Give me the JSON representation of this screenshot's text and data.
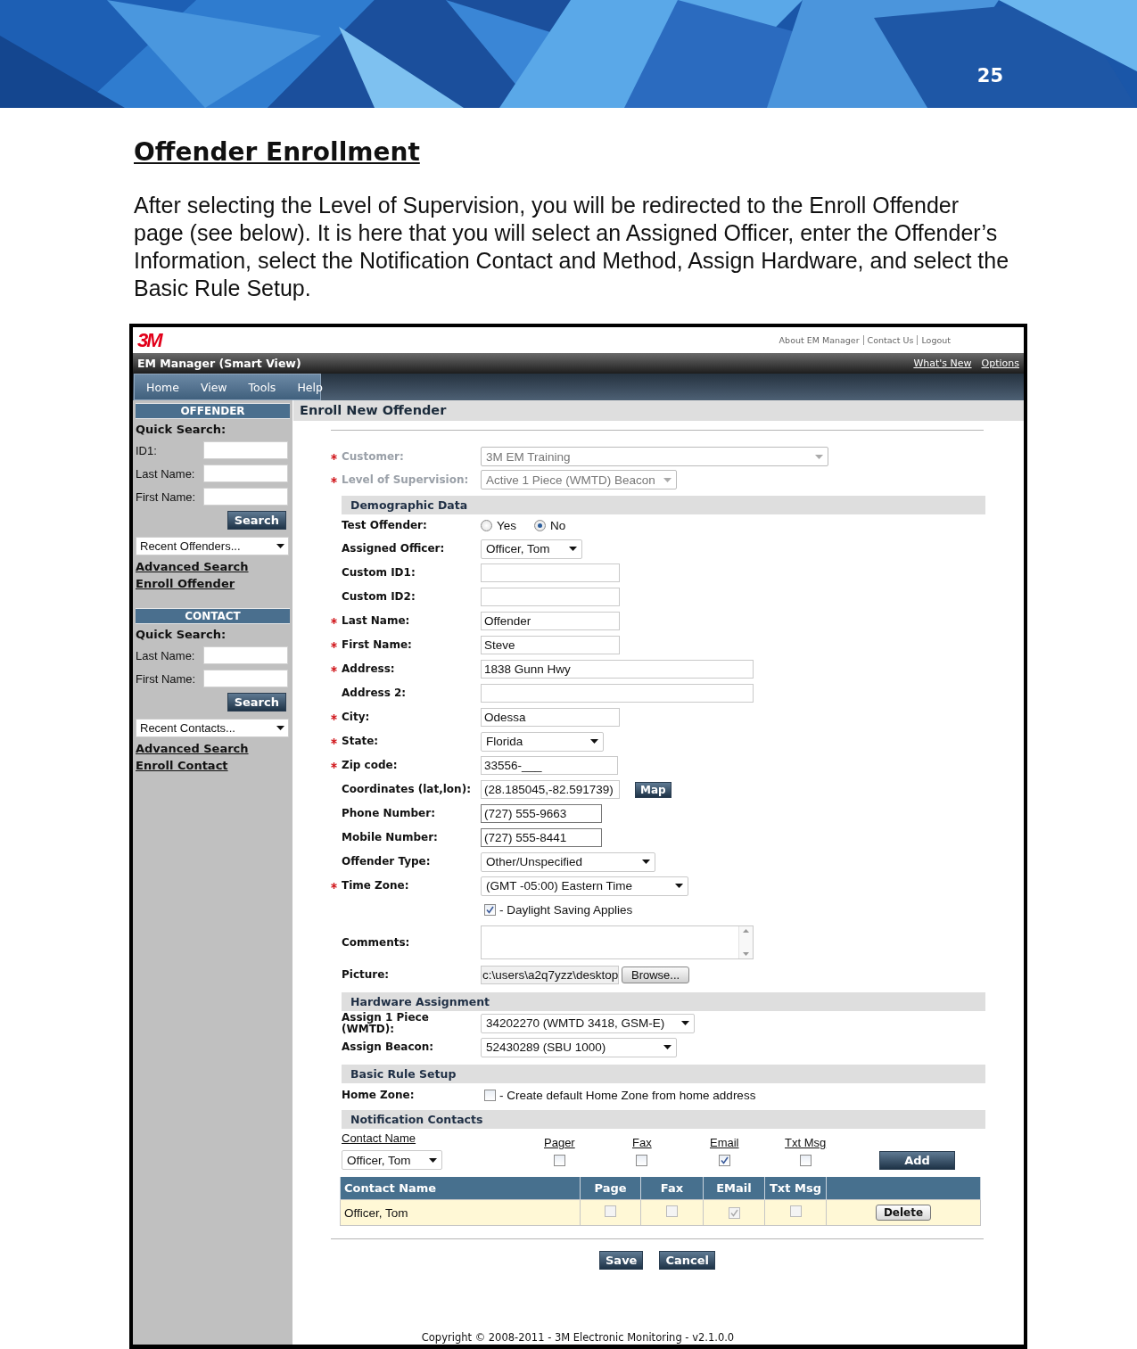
{
  "page_number": "25",
  "heading": "Offender Enrollment",
  "intro": "After selecting the Level of Supervision, you will be redirected to the Enroll Offender page (see below). It is here that you will select an Assigned Officer, enter the Offender’s Information, select the Notification Contact and Method, Assign Hardware, and select the Basic Rule Setup.",
  "app": {
    "logo": "3M",
    "top_links": [
      "About EM Manager",
      "Contact Us",
      "Logout"
    ],
    "title": "EM Manager (Smart View)",
    "title_links": [
      "What's New",
      "Options"
    ],
    "menu": [
      "Home",
      "View",
      "Tools",
      "Help"
    ],
    "sidebar": [
      {
        "heading": "OFFENDER",
        "quick_search": "Quick Search:",
        "fields": [
          "ID1:",
          "Last Name:",
          "First Name:"
        ],
        "button": "Search",
        "recent": "Recent Offenders...",
        "links": [
          "Advanced Search",
          "Enroll Offender"
        ]
      },
      {
        "heading": "CONTACT",
        "quick_search": "Quick Search:",
        "fields": [
          "Last Name:",
          "First Name:"
        ],
        "button": "Search",
        "recent": "Recent Contacts...",
        "links": [
          "Advanced Search",
          "Enroll Contact"
        ]
      }
    ],
    "page_title": "Enroll New Offender",
    "top_rows": [
      {
        "label": "Customer:",
        "required": true,
        "disabled": true,
        "kind": "select",
        "value": "3M EM Training"
      },
      {
        "label": "Level of Supervision:",
        "required": true,
        "disabled": true,
        "kind": "select",
        "value": "Active 1 Piece (WMTD) Beacon"
      }
    ],
    "sections": [
      {
        "title": "Demographic Data",
        "rows": [
          {
            "label": "Test Offender:",
            "required": false,
            "kind": "radio",
            "options": [
              {
                "label": "Yes",
                "selected": false
              },
              {
                "label": "No",
                "selected": true
              }
            ]
          },
          {
            "label": "Assigned Officer:",
            "required": false,
            "kind": "select",
            "value": "Officer, Tom"
          },
          {
            "label": "Custom ID1:",
            "required": false,
            "kind": "input"
          },
          {
            "label": "Custom ID2:",
            "required": false,
            "kind": "input"
          },
          {
            "label": "Last Name:",
            "required": true,
            "kind": "input",
            "value": "Offender"
          },
          {
            "label": "First Name:",
            "required": true,
            "kind": "input",
            "value": "Steve"
          },
          {
            "label": "Address:",
            "required": true,
            "kind": "input",
            "value": "1838 Gunn Hwy"
          },
          {
            "label": "Address 2:",
            "required": false,
            "kind": "input"
          },
          {
            "label": "City:",
            "required": true,
            "kind": "input",
            "value": "Odessa"
          },
          {
            "label": "State:",
            "required": true,
            "kind": "select",
            "value": "Florida"
          },
          {
            "label": "Zip code:",
            "required": true,
            "kind": "input",
            "value": "33556-___"
          },
          {
            "label": "Coordinates (lat,lon):",
            "required": false,
            "kind": "input_button",
            "value": "(28.185045,-82.591739)",
            "button": "Map"
          },
          {
            "label": "Phone Number:",
            "required": false,
            "kind": "input",
            "value": "(727) 555-9663"
          },
          {
            "label": "Mobile Number:",
            "required": false,
            "kind": "input",
            "value": "(727) 555-8441"
          },
          {
            "label": "Offender Type:",
            "required": false,
            "kind": "select",
            "value": "Other/Unspecified"
          },
          {
            "label": "Time Zone:",
            "required": true,
            "kind": "select",
            "value": "(GMT -05:00) Eastern Time"
          },
          {
            "required": false,
            "kind": "checkbox",
            "checked": true,
            "text": "- Daylight Saving Applies"
          },
          {
            "label": "Comments:",
            "required": false,
            "kind": "textarea"
          },
          {
            "label": "Picture:",
            "required": false,
            "kind": "file",
            "value": "c:\\users\\a2q7yzz\\desktop",
            "button": "Browse..."
          }
        ]
      },
      {
        "title": "Hardware Assignment",
        "rows": [
          {
            "label": "Assign 1 Piece (WMTD):",
            "required": false,
            "kind": "select",
            "value": "34202270 (WMTD 3418, GSM-E)"
          },
          {
            "label": "Assign Beacon:",
            "required": false,
            "kind": "select",
            "value": "52430289 (SBU 1000)"
          }
        ]
      },
      {
        "title": "Basic Rule Setup",
        "rows": [
          {
            "label": "Home Zone:",
            "required": false,
            "kind": "checkbox",
            "checked": false,
            "text": "- Create default Home Zone from home address"
          }
        ]
      }
    ],
    "notification": {
      "title": "Notification Contacts",
      "contact_header": "Contact Name",
      "contact": "Officer, Tom",
      "methods": [
        {
          "label": "Pager",
          "checked": false
        },
        {
          "label": "Fax",
          "checked": false
        },
        {
          "label": "Email",
          "checked": true
        },
        {
          "label": "Txt Msg",
          "checked": false
        }
      ],
      "add": "Add",
      "table": {
        "columns": [
          "Contact Name",
          "Page",
          "Fax",
          "EMail",
          "Txt Msg"
        ],
        "rows": [
          {
            "name": "Officer, Tom",
            "checks": [
              false,
              false,
              true,
              false
            ],
            "action": "Delete"
          }
        ]
      }
    },
    "actions": [
      "Save",
      "Cancel"
    ],
    "footer": "Copyright © 2008-2011 - 3M Electronic Monitoring - v2.1.0.0"
  }
}
